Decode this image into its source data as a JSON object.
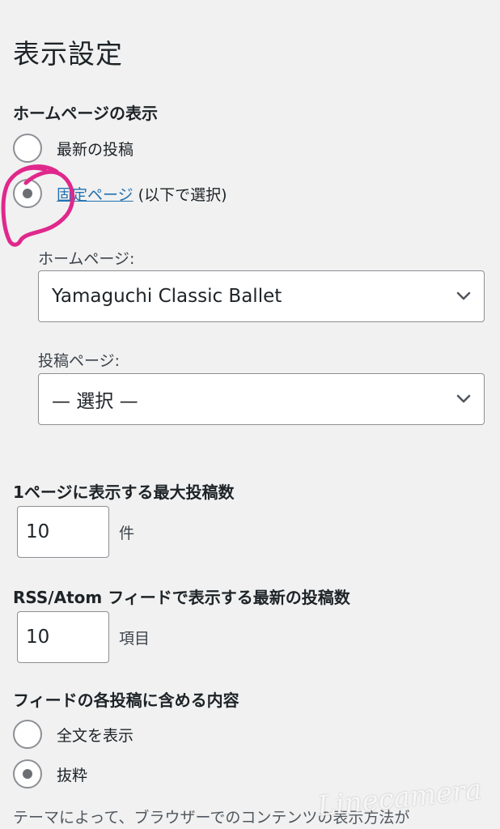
{
  "page": {
    "title": "表示設定"
  },
  "homepage_display": {
    "heading": "ホームページの表示",
    "options": [
      {
        "label": "最新の投稿",
        "selected": false
      },
      {
        "link_label": "固定ページ",
        "suffix": " (以下で選択)",
        "selected": true
      }
    ],
    "homepage": {
      "label": "ホームページ:",
      "value": "Yamaguchi Classic Ballet"
    },
    "posts_page": {
      "label": "投稿ページ:",
      "value": "— 選択 —"
    }
  },
  "posts_per_page": {
    "label": "1ページに表示する最大投稿数",
    "value": "10",
    "unit": "件"
  },
  "feed_posts": {
    "label": "RSS/Atom フィードで表示する最新の投稿数",
    "value": "10",
    "unit": "項目"
  },
  "feed_content": {
    "heading": "フィードの各投稿に含める内容",
    "options": [
      {
        "label": "全文を表示",
        "selected": false
      },
      {
        "label": "抜粋",
        "selected": true
      }
    ],
    "description": "テーマによって、ブラウザーでのコンテンツの表示方法が"
  },
  "watermark": {
    "text": "Linecamera"
  },
  "colors": {
    "link": "#2271b1",
    "annotation": "#e0288c",
    "background": "#f1f1f1"
  },
  "icons": {
    "select_arrow": "chevron-down-icon"
  }
}
